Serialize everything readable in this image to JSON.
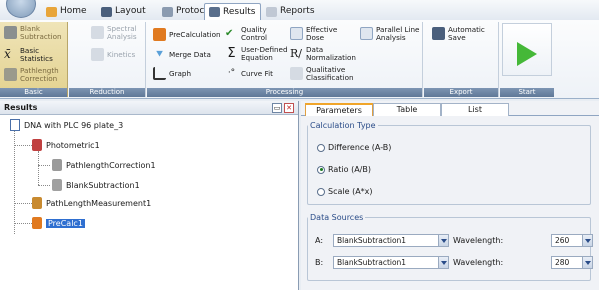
{
  "tabs": [
    {
      "label": "Home",
      "icon": "home-icon"
    },
    {
      "label": "Layout",
      "icon": "layout-icon"
    },
    {
      "label": "Protocol",
      "icon": "protocol-icon"
    },
    {
      "label": "Results",
      "icon": "results-icon"
    },
    {
      "label": "Reports",
      "icon": "reports-icon"
    }
  ],
  "active_tab": "Results",
  "ribbon": {
    "groups": {
      "basic": "Basic",
      "reduction": "Reduction",
      "processing": "Processing",
      "export": "Export",
      "start": "Start"
    },
    "basic": {
      "blank": [
        "Blank",
        "Subtraction"
      ],
      "stats": [
        "Basic",
        "Statistics"
      ],
      "path": [
        "Pathlength",
        "Correction"
      ]
    },
    "reduction": {
      "spectral": [
        "Spectral",
        "Analysis"
      ],
      "kinetics": "Kinetics"
    },
    "processing": {
      "precalc": "PreCalculation",
      "merge": "Merge Data",
      "graph": "Graph",
      "quality": [
        "Quality",
        "Control"
      ],
      "userdef": [
        "User-Defined",
        "Equation"
      ],
      "curve": "Curve Fit",
      "ed": [
        "Effective",
        "Dose"
      ],
      "datanorm": [
        "Data",
        "Normalization"
      ],
      "qual": [
        "Qualitative",
        "Classification"
      ],
      "parallel": [
        "Parallel Line",
        "Analysis"
      ]
    },
    "export": {
      "autosave": [
        "Automatic",
        "Save"
      ]
    }
  },
  "results_panel": {
    "title": "Results",
    "tree": [
      {
        "label": "DNA with PLC 96 plate_3"
      },
      {
        "label": "Photometric1"
      },
      {
        "label": "PathlengthCorrection1"
      },
      {
        "label": "BlankSubtraction1"
      },
      {
        "label": "PathLengthMeasurement1"
      },
      {
        "label": "PreCalc1"
      }
    ],
    "selected": "PreCalc1"
  },
  "params": {
    "tabs": [
      "Parameters",
      "Table",
      "List"
    ],
    "calc_type_legend": "Calculation Type",
    "calc_options": [
      "Difference (A-B)",
      "Ratio (A/B)",
      "Scale (A*x)"
    ],
    "calc_selected": "Ratio (A/B)",
    "data_sources_legend": "Data Sources",
    "rows": [
      {
        "key": "A:",
        "source": "BlankSubtraction1",
        "wl_label": "Wavelength:",
        "wavelength": "260"
      },
      {
        "key": "B:",
        "source": "BlankSubtraction1",
        "wl_label": "Wavelength:",
        "wavelength": "280"
      }
    ]
  },
  "colors": {
    "accent": "#f0a52a",
    "selection": "#2f6fd0",
    "start_green": "#45b838"
  }
}
